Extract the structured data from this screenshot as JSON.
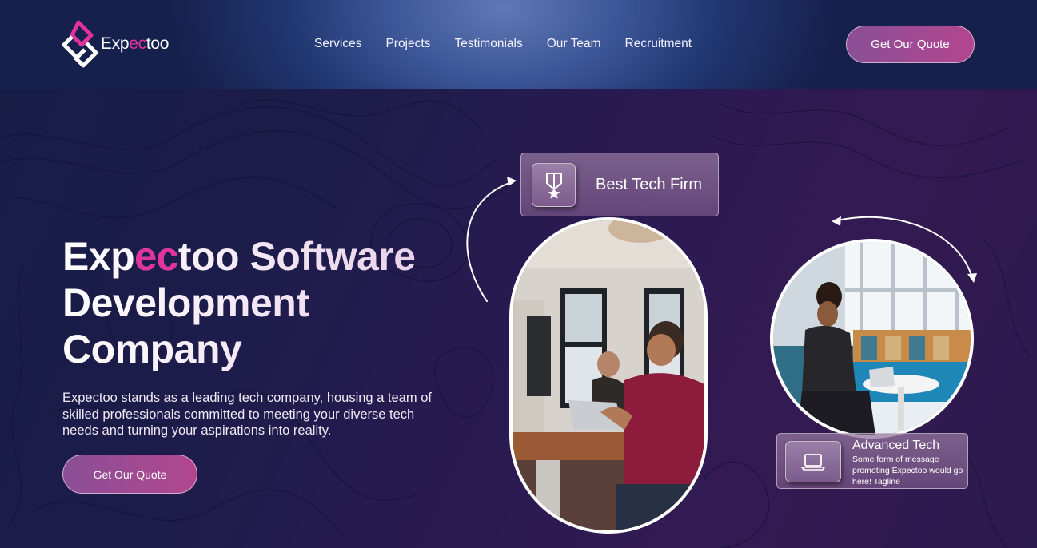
{
  "brand": {
    "name_start": "Exp",
    "name_highlight": "ec",
    "name_end": "too",
    "accent_color": "#e1339a"
  },
  "nav": {
    "items": [
      "Services",
      "Projects",
      "Testimonials",
      "Our Team",
      "Recruitment"
    ]
  },
  "header": {
    "cta_label": "Get Our Quote"
  },
  "hero": {
    "title_start": "Exp",
    "title_highlight": "ec",
    "title_rest_line1": "too Software",
    "title_line2": "Development",
    "title_line3": "Company",
    "description": "Expectoo stands as a leading tech company, housing a team of skilled professionals committed to meeting your diverse tech needs and turning your aspirations into reality.",
    "cta_label": "Get Our Quote"
  },
  "cards": {
    "best_tech": {
      "title": "Best Tech Firm",
      "icon": "medal-icon"
    },
    "advanced_tech": {
      "title": "Advanced Tech",
      "text": "Some form of message promoting Expectoo would go here! Tagline",
      "icon": "laptop-icon"
    }
  },
  "photos": {
    "team_photo": "two people working at laptops in an office",
    "woman_photo": "woman working on a tablet in a lounge"
  }
}
